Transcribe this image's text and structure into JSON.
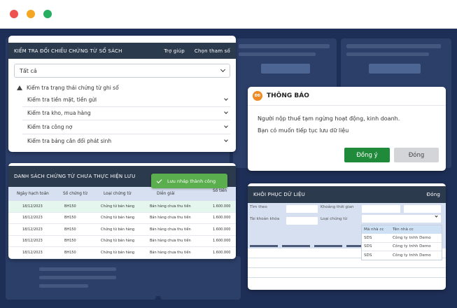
{
  "colors": {
    "desktop": "#1e2f57",
    "panel_header": "#2c3a4d",
    "accent_green": "#1f8a3a",
    "toast_green": "#5aae4d",
    "table_header": "#d6e0f0",
    "window_dot_red": "#ef5350",
    "window_dot_yellow": "#f5a623",
    "window_dot_green": "#27ae60"
  },
  "check_panel": {
    "title": "KIỂM TRA ĐỐI CHIẾU CHỨNG TỪ SỔ SÁCH",
    "help_link": "Trợ giúp",
    "select_params_link": "Chọn tham số",
    "filter_value": "Tất cả",
    "warning_label": "Kiểm tra trạng thái chứng từ ghi sổ",
    "items": [
      {
        "label": "Kiểm tra tiền mặt, tiền gửi"
      },
      {
        "label": "Kiểm tra kho, mua hàng"
      },
      {
        "label": "Kiểm tra công nợ"
      },
      {
        "label": "Kiểm tra bảng cân đối phát sinh"
      }
    ]
  },
  "pending_panel": {
    "title": "DANH SÁCH CHỨNG TỪ CHƯA THỰC HIỆN LƯU",
    "columns": [
      "Ngày hạch toán",
      "Số chứng từ",
      "Loại chứng từ",
      "Diễn giải",
      "Số tiền"
    ],
    "rows": [
      {
        "date": "18/12/2023",
        "number": "BH150",
        "type": "Chứng từ bán hàng",
        "desc": "Bán hàng chưa thu tiền",
        "amount": "1.600.000"
      },
      {
        "date": "18/12/2023",
        "number": "BH150",
        "type": "Chứng từ bán hàng",
        "desc": "Bán hàng chưa thu tiền",
        "amount": "1.600.000"
      },
      {
        "date": "18/12/2023",
        "number": "BH150",
        "type": "Chứng từ bán hàng",
        "desc": "Bán hàng chưa thu tiền",
        "amount": "1.600.000"
      },
      {
        "date": "18/12/2023",
        "number": "BH150",
        "type": "Chứng từ bán hàng",
        "desc": "Bán hàng chưa thu tiền",
        "amount": "1.600.000"
      },
      {
        "date": "18/12/2023",
        "number": "BH150",
        "type": "Chứng từ bán hàng",
        "desc": "Bán hàng chưa thu tiền",
        "amount": "1.600.000"
      }
    ],
    "toast": "Lưu nháp thành công"
  },
  "notice": {
    "title": "THÔNG BÁO",
    "logo_text": "ĐĐ",
    "line1": "Người nộp thuế tạm ngừng hoạt động, kinh doanh.",
    "line2": "Bạn có muốn tiếp tục lưu dữ liệu",
    "ok_label": "Đồng ý",
    "close_label": "Đóng"
  },
  "restore_panel": {
    "title": "KHÔI PHỤC DỮ LIỆU",
    "close_link": "Đóng",
    "search_by_label": "Tìm theo",
    "period_label": "Khoảng thời gian",
    "lock_account_label": "Tài khoản khóa",
    "doc_type_label": "Loại chứng từ",
    "dropdown": {
      "headers": [
        "Mã nhà cc",
        "Tên nhà cc"
      ],
      "rows": [
        {
          "code": "SDS",
          "name": "Công ty tnhh Demo"
        },
        {
          "code": "SDS",
          "name": "Công ty tnhh Demo"
        },
        {
          "code": "SDS",
          "name": "Công ty tnhh Demo"
        }
      ]
    }
  }
}
